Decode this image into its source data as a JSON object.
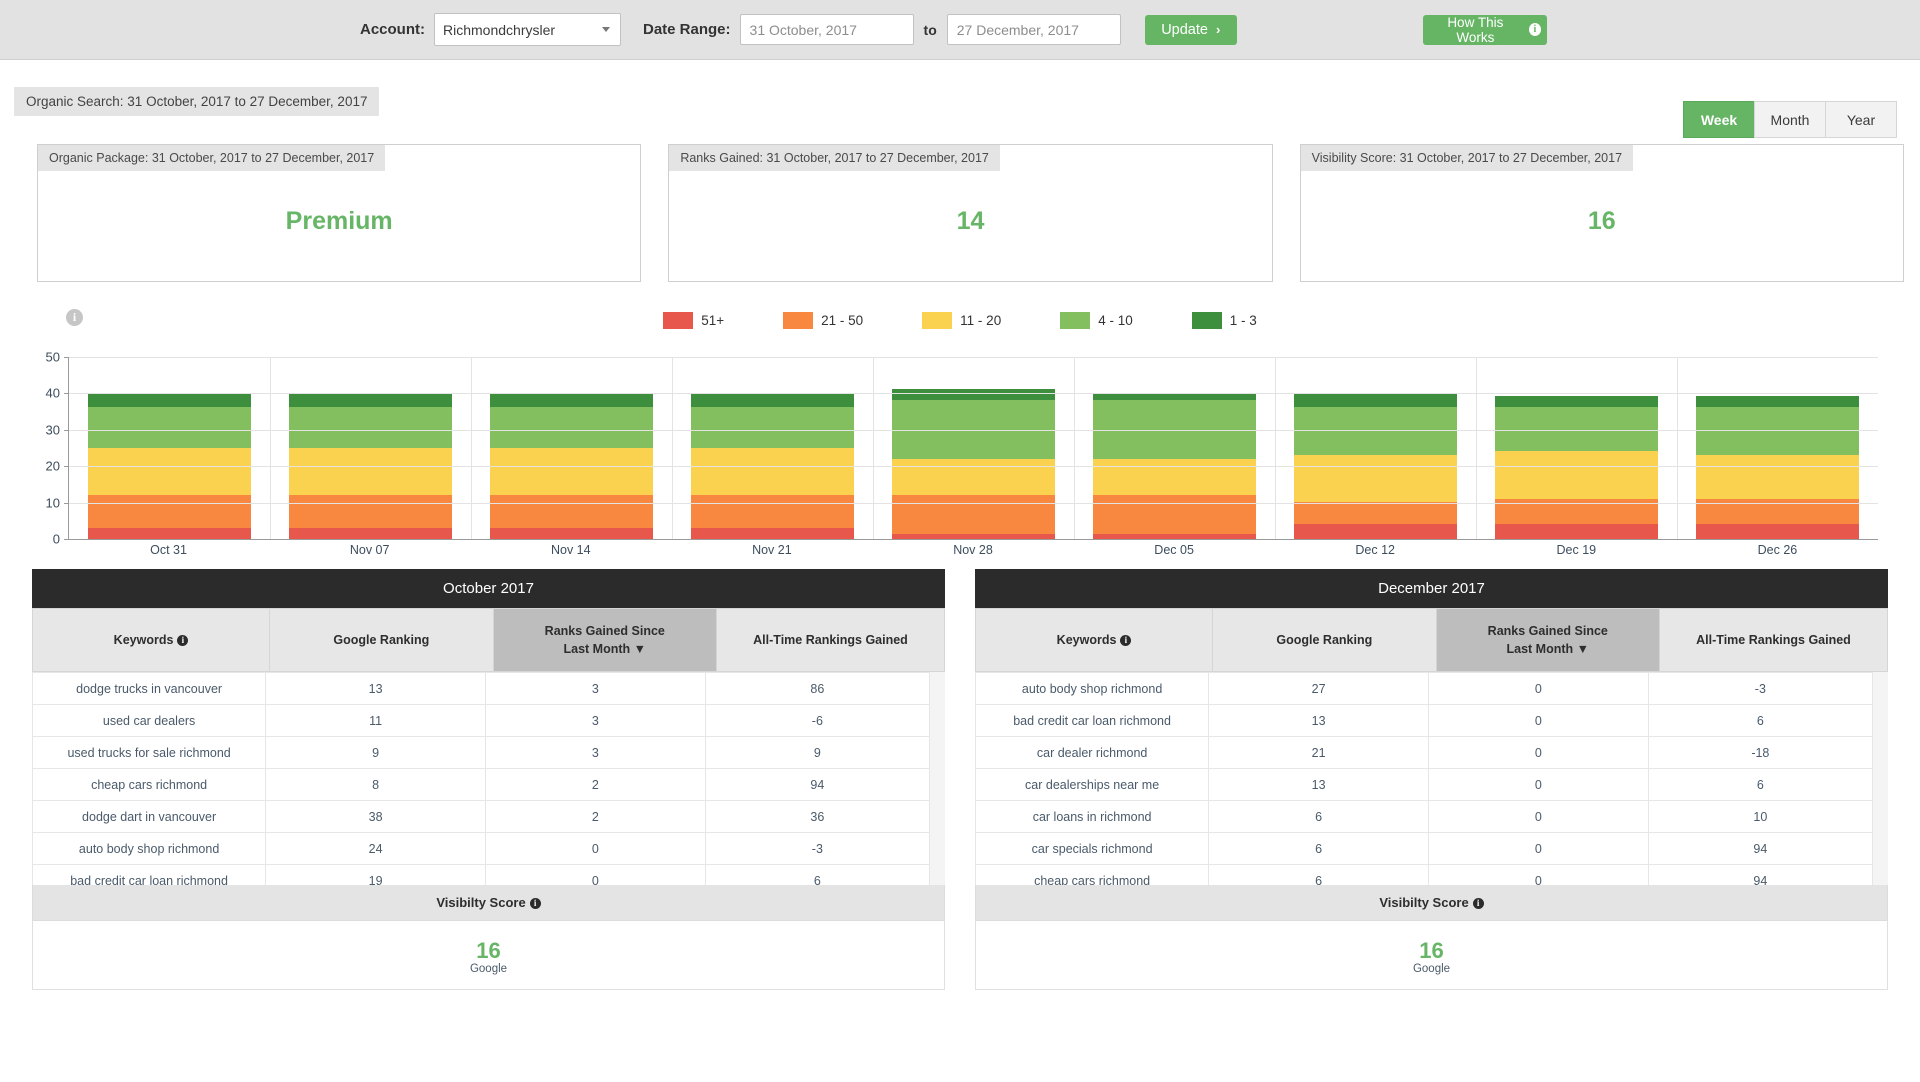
{
  "topbar": {
    "account_label": "Account:",
    "account_value": "Richmondchrysler",
    "date_range_label": "Date Range:",
    "date_from": "31 October, 2017",
    "to_label": "to",
    "date_to": "27 December, 2017",
    "update_label": "Update",
    "update_chevron": "›",
    "how_label": "How This Works",
    "info_glyph": "i"
  },
  "panel": {
    "title": "Organic Search: 31 October, 2017 to 27 December, 2017",
    "segments": [
      {
        "label": "Week",
        "active": true
      },
      {
        "label": "Month",
        "active": false
      },
      {
        "label": "Year",
        "active": false
      }
    ]
  },
  "cards": [
    {
      "tag": "Organic Package: 31 October, 2017 to 27 December, 2017",
      "value": "Premium"
    },
    {
      "tag": "Ranks Gained: 31 October, 2017 to 27 December, 2017",
      "value": "14"
    },
    {
      "tag": "Visibility Score: 31 October, 2017 to 27 December, 2017",
      "value": "16"
    }
  ],
  "colors": {
    "accent_green": "#66b565",
    "value_green": "#67b566",
    "band_51plus": "#e8574b",
    "band_21_50": "#f8873f",
    "band_11_20": "#fbd24f",
    "band_4_10": "#84bf5f",
    "band_1_3": "#3d8f3d",
    "header_dark": "#2b2b2b"
  },
  "chart_data": {
    "type": "bar",
    "stacked": true,
    "title": "",
    "xlabel": "",
    "ylabel": "",
    "ylim": [
      0,
      50
    ],
    "yticks": [
      0,
      10,
      20,
      30,
      40,
      50
    ],
    "grid": true,
    "legend_position": "top",
    "categories": [
      "Oct 31",
      "Nov 07",
      "Nov 14",
      "Nov 21",
      "Nov 28",
      "Dec 05",
      "Dec 12",
      "Dec 19",
      "Dec 26"
    ],
    "series": [
      {
        "name": "51+",
        "color": "#e8574b",
        "values": [
          3,
          3,
          3,
          3,
          1.5,
          1.5,
          4,
          4,
          4
        ]
      },
      {
        "name": "21 - 50",
        "color": "#f8873f",
        "values": [
          9,
          9,
          9,
          9,
          10.5,
          10.5,
          6,
          7,
          7
        ]
      },
      {
        "name": "11 - 20",
        "color": "#fbd24f",
        "values": [
          13,
          13,
          13,
          13,
          10,
          10,
          13,
          13,
          12
        ]
      },
      {
        "name": "4 - 10",
        "color": "#84bf5f",
        "values": [
          11,
          11,
          11,
          11,
          16,
          16,
          13,
          12,
          13
        ]
      },
      {
        "name": "1 - 3",
        "color": "#3d8f3d",
        "values": [
          4,
          4,
          4,
          4,
          3,
          2,
          4,
          3,
          3
        ]
      }
    ],
    "legend": [
      {
        "label": "51+",
        "color": "#e8574b"
      },
      {
        "label": "21 - 50",
        "color": "#f8873f"
      },
      {
        "label": "11 - 20",
        "color": "#fbd24f"
      },
      {
        "label": "4 - 10",
        "color": "#84bf5f"
      },
      {
        "label": "1 - 3",
        "color": "#3d8f3d"
      }
    ]
  },
  "tables": [
    {
      "title": "October 2017",
      "columns": [
        "Keywords",
        "Google Ranking",
        "Ranks Gained Since Last Month",
        "All-Time Rankings Gained"
      ],
      "sorted_column_index": 2,
      "sort_arrow": "▼",
      "rows": [
        [
          "dodge trucks in vancouver",
          "13",
          "3",
          "86"
        ],
        [
          "used car dealers",
          "11",
          "3",
          "-6"
        ],
        [
          "used trucks for sale richmond",
          "9",
          "3",
          "9"
        ],
        [
          "cheap cars richmond",
          "8",
          "2",
          "94"
        ],
        [
          "dodge dart in vancouver",
          "38",
          "2",
          "36"
        ],
        [
          "auto body shop richmond",
          "24",
          "0",
          "-3"
        ],
        [
          "bad credit car loan richmond",
          "19",
          "0",
          "6"
        ]
      ],
      "visibility_header": "Visibilty Score",
      "visibility_value": "16",
      "visibility_sub": "Google"
    },
    {
      "title": "December 2017",
      "columns": [
        "Keywords",
        "Google Ranking",
        "Ranks Gained Since Last Month",
        "All-Time Rankings Gained"
      ],
      "sorted_column_index": 2,
      "sort_arrow": "▼",
      "rows": [
        [
          "auto body shop richmond",
          "27",
          "0",
          "-3"
        ],
        [
          "bad credit car loan richmond",
          "13",
          "0",
          "6"
        ],
        [
          "car dealer richmond",
          "21",
          "0",
          "-18"
        ],
        [
          "car dealerships near me",
          "13",
          "0",
          "6"
        ],
        [
          "car loans in richmond",
          "6",
          "0",
          "10"
        ],
        [
          "car specials richmond",
          "6",
          "0",
          "94"
        ],
        [
          "cheap cars richmond",
          "6",
          "0",
          "94"
        ]
      ],
      "visibility_header": "Visibilty Score",
      "visibility_value": "16",
      "visibility_sub": "Google"
    }
  ]
}
